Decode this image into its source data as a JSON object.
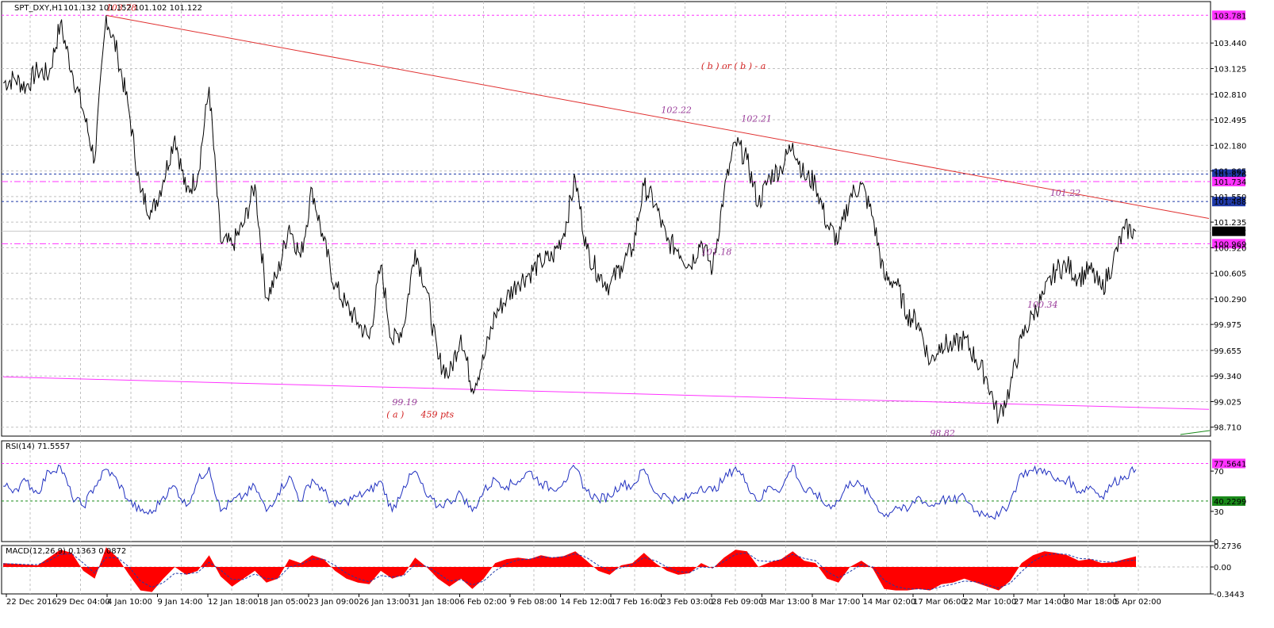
{
  "header": {
    "symbol": "SPT_DXY,H1",
    "ohlc": "101.132 101.152 101.102 101.122"
  },
  "colors": {
    "price_line": "#000000",
    "resistance_trend": "#e03030",
    "support_trend": "#ff33ff",
    "level_blue": "#1f3aa8",
    "level_magenta": "#ff33ff",
    "annotation_red": "#d21e1e",
    "annotation_purple": "#9a3c9a",
    "rsi_line": "#2030c0",
    "macd_hist": "#ff0000",
    "macd_signal": "#1f3aa8",
    "grid": "#c0c0c0"
  },
  "chart_data": [
    {
      "type": "line",
      "title": "SPT_DXY,H1",
      "ylim": [
        98.6,
        103.95
      ],
      "y_ticks": [
        103.44,
        103.125,
        102.81,
        102.495,
        102.18,
        101.865,
        101.55,
        101.235,
        100.92,
        100.605,
        100.29,
        99.975,
        99.655,
        99.34,
        99.025,
        98.71
      ],
      "y_tick_labels": [
        "103.440",
        "103.125",
        "102.810",
        "102.495",
        "102.180",
        "101.865",
        "101.550",
        "101.235",
        "100.920",
        "100.605",
        "100.290",
        "99.975",
        "99.655",
        "99.340",
        "99.025",
        "98.710"
      ],
      "x_labels": [
        "22 Dec 2016",
        "29 Dec 04:00",
        "4 Jan 10:00",
        "9 Jan 14:00",
        "12 Jan 18:00",
        "18 Jan 05:00",
        "23 Jan 09:00",
        "26 Jan 13:00",
        "31 Jan 18:00",
        "6 Feb 02:00",
        "9 Feb 08:00",
        "14 Feb 12:00",
        "17 Feb 16:00",
        "23 Feb 03:00",
        "28 Feb 09:00",
        "3 Mar 13:00",
        "8 Mar 17:00",
        "14 Mar 02:00",
        "17 Mar 06:00",
        "22 Mar 10:00",
        "27 Mar 14:00",
        "30 Mar 18:00",
        "5 Apr 02:00"
      ],
      "series": [
        {
          "values": [
            102.95,
            103.0,
            102.9,
            103.1,
            103.05,
            103.68,
            103.1,
            102.6,
            102.0,
            103.78,
            103.3,
            102.6,
            101.6,
            101.35,
            101.75,
            102.3,
            101.6,
            101.8,
            102.9,
            101.0,
            100.95,
            101.2,
            101.7,
            100.3,
            100.6,
            101.2,
            100.8,
            101.65,
            101.0,
            100.45,
            100.2,
            100.0,
            99.8,
            100.7,
            99.75,
            99.95,
            100.9,
            100.4,
            99.55,
            99.35,
            99.85,
            99.19,
            99.55,
            100.1,
            100.3,
            100.5,
            100.6,
            100.75,
            100.8,
            101.1,
            101.77,
            100.9,
            100.6,
            100.45,
            100.7,
            100.9,
            101.68,
            101.45,
            101.0,
            100.9,
            100.7,
            101.0,
            100.65,
            101.6,
            102.22,
            102.0,
            101.45,
            101.8,
            101.9,
            102.21,
            101.8,
            101.72,
            101.2,
            101.0,
            101.55,
            101.7,
            101.3,
            100.55,
            100.5,
            100.1,
            100.0,
            99.5,
            99.75,
            99.7,
            99.8,
            99.55,
            99.3,
            98.82,
            99.2,
            99.8,
            100.1,
            100.35,
            100.65,
            100.7,
            100.55,
            100.65,
            100.4,
            100.75,
            101.15,
            101.122
          ],
          "line_color": "#000000"
        }
      ],
      "levels": [
        {
          "value": 103.781,
          "label": "103.781",
          "style": "dashed",
          "color": "#ff33ff"
        },
        {
          "value": 101.826,
          "label": "101.826",
          "style": "dashed",
          "color": "#1f3aa8"
        },
        {
          "value": 101.734,
          "label": "101.734",
          "style": "dash-dot",
          "color": "#ff33ff"
        },
        {
          "value": 101.488,
          "label": "101.488",
          "style": "dashed",
          "color": "#1f3aa8"
        },
        {
          "value": 101.122,
          "label": "101.122",
          "style": "solid-current",
          "color": "#000000"
        },
        {
          "value": 100.969,
          "label": "100.969",
          "style": "dash-dot",
          "color": "#ff33ff"
        }
      ],
      "trendlines": [
        {
          "from": [
            9,
            103.78
          ],
          "to": [
            99.999,
            101.28
          ],
          "color": "#e03030"
        },
        {
          "from": [
            0,
            99.33
          ],
          "to": [
            99.999,
            98.93
          ],
          "color": "#ff33ff"
        }
      ],
      "annotations": [
        {
          "text": "103.78",
          "at": [
            9,
            103.84
          ],
          "color": "#d21e1e"
        },
        {
          "text": "( b ) or ( b ) - a",
          "at": [
            61,
            103.12
          ],
          "color": "#d21e1e"
        },
        {
          "text": "102.22",
          "at": [
            57.5,
            102.58
          ],
          "color": "#9a3c9a"
        },
        {
          "text": "102.21",
          "at": [
            64.5,
            102.47
          ],
          "color": "#9a3c9a"
        },
        {
          "text": "101.22",
          "at": [
            91.5,
            101.56
          ],
          "color": "#9a3c9a"
        },
        {
          "text": "101.18",
          "at": [
            61,
            100.83
          ],
          "color": "#9a3c9a"
        },
        {
          "text": "100.34",
          "at": [
            89.5,
            100.18
          ],
          "color": "#9a3c9a"
        },
        {
          "text": "99.19",
          "at": [
            34,
            98.98
          ],
          "color": "#9a3c9a"
        },
        {
          "text": "( a )",
          "at": [
            33.5,
            98.83
          ],
          "color": "#d21e1e"
        },
        {
          "text": "459 pts",
          "at": [
            36.5,
            98.83
          ],
          "color": "#d21e1e"
        },
        {
          "text": "98.82",
          "at": [
            81,
            98.6
          ],
          "color": "#9a3c9a"
        }
      ]
    },
    {
      "type": "line",
      "title": "RSI(14) 71.5557",
      "ylim": [
        0,
        100
      ],
      "y_tick_labels": [
        "70",
        "30",
        "0"
      ],
      "y_ticks": [
        70,
        30,
        0
      ],
      "levels": [
        {
          "value": 77.5641,
          "label": "77.5641",
          "color": "#ff33ff"
        },
        {
          "value": 40.2299,
          "label": "40.2299",
          "color": "#1a8a1a"
        }
      ],
      "series": [
        {
          "values": [
            55,
            52,
            60,
            48,
            70,
            75,
            45,
            35,
            55,
            72,
            60,
            40,
            30,
            28,
            45,
            55,
            35,
            60,
            74,
            30,
            40,
            45,
            55,
            30,
            48,
            65,
            40,
            62,
            50,
            35,
            40,
            45,
            50,
            60,
            30,
            55,
            70,
            45,
            35,
            40,
            48,
            30,
            50,
            62,
            55,
            60,
            70,
            58,
            52,
            60,
            73,
            50,
            42,
            45,
            58,
            55,
            72,
            48,
            45,
            40,
            45,
            55,
            50,
            62,
            74,
            58,
            40,
            55,
            52,
            76,
            50,
            48,
            35,
            40,
            60,
            55,
            42,
            25,
            35,
            30,
            45,
            35,
            42,
            40,
            45,
            30,
            28,
            25,
            40,
            68,
            70,
            72,
            60,
            62,
            50,
            55,
            45,
            58,
            65,
            71.5557
          ],
          "line_color": "#2030c0"
        }
      ]
    },
    {
      "type": "area",
      "title": "MACD(12,26,9) 0.1363 0.0872",
      "ylim": [
        -0.3443,
        0.2736
      ],
      "y_tick_labels": [
        "0.2736",
        "0.00",
        "-0.3443"
      ],
      "y_ticks": [
        0.2736,
        0.0,
        -0.3443
      ],
      "series": [
        {
          "name": "MACD",
          "values": [
            0.05,
            0.04,
            0.03,
            0.02,
            0.12,
            0.22,
            0.18,
            -0.05,
            -0.15,
            0.25,
            0.12,
            -0.1,
            -0.3,
            -0.32,
            -0.15,
            0.0,
            -0.1,
            -0.05,
            0.15,
            -0.12,
            -0.25,
            -0.15,
            -0.05,
            -0.2,
            -0.15,
            0.1,
            0.05,
            0.15,
            0.1,
            -0.05,
            -0.15,
            -0.2,
            -0.22,
            -0.05,
            -0.15,
            -0.1,
            0.12,
            0.0,
            -0.15,
            -0.25,
            -0.15,
            -0.28,
            -0.15,
            0.05,
            0.1,
            0.12,
            0.1,
            0.15,
            0.12,
            0.14,
            0.2,
            0.08,
            -0.05,
            -0.1,
            0.02,
            0.05,
            0.18,
            0.05,
            -0.05,
            -0.1,
            -0.08,
            0.05,
            -0.02,
            0.12,
            0.22,
            0.2,
            0.0,
            0.06,
            0.1,
            0.2,
            0.08,
            0.05,
            -0.15,
            -0.2,
            0.0,
            0.08,
            -0.02,
            -0.28,
            -0.3,
            -0.3,
            -0.28,
            -0.3,
            -0.22,
            -0.2,
            -0.15,
            -0.2,
            -0.25,
            -0.3,
            -0.18,
            0.05,
            0.15,
            0.2,
            0.18,
            0.15,
            0.08,
            0.1,
            0.05,
            0.06,
            0.1,
            0.1363
          ],
          "color": "#ff0000"
        },
        {
          "name": "Signal",
          "values": [
            0.04,
            0.04,
            0.03,
            0.03,
            0.08,
            0.16,
            0.17,
            0.05,
            -0.08,
            0.12,
            0.12,
            0.0,
            -0.18,
            -0.26,
            -0.2,
            -0.08,
            -0.09,
            -0.07,
            0.06,
            -0.04,
            -0.16,
            -0.16,
            -0.09,
            -0.15,
            -0.15,
            0.0,
            0.03,
            0.1,
            0.1,
            0.02,
            -0.08,
            -0.15,
            -0.19,
            -0.11,
            -0.13,
            -0.11,
            0.03,
            0.01,
            -0.08,
            -0.18,
            -0.16,
            -0.23,
            -0.18,
            -0.05,
            0.04,
            0.09,
            0.1,
            0.13,
            0.12,
            0.13,
            0.17,
            0.12,
            0.02,
            -0.05,
            -0.01,
            0.03,
            0.12,
            0.08,
            0.0,
            -0.06,
            -0.07,
            0.0,
            -0.01,
            0.07,
            0.16,
            0.18,
            0.08,
            0.07,
            0.09,
            0.16,
            0.11,
            0.08,
            -0.06,
            -0.14,
            -0.06,
            0.03,
            0.0,
            -0.17,
            -0.25,
            -0.28,
            -0.28,
            -0.29,
            -0.25,
            -0.22,
            -0.18,
            -0.19,
            -0.23,
            -0.27,
            -0.21,
            -0.06,
            0.07,
            0.15,
            0.17,
            0.16,
            0.11,
            0.1,
            0.07,
            0.06,
            0.08,
            0.0872
          ],
          "color": "#1f3aa8"
        }
      ]
    }
  ]
}
